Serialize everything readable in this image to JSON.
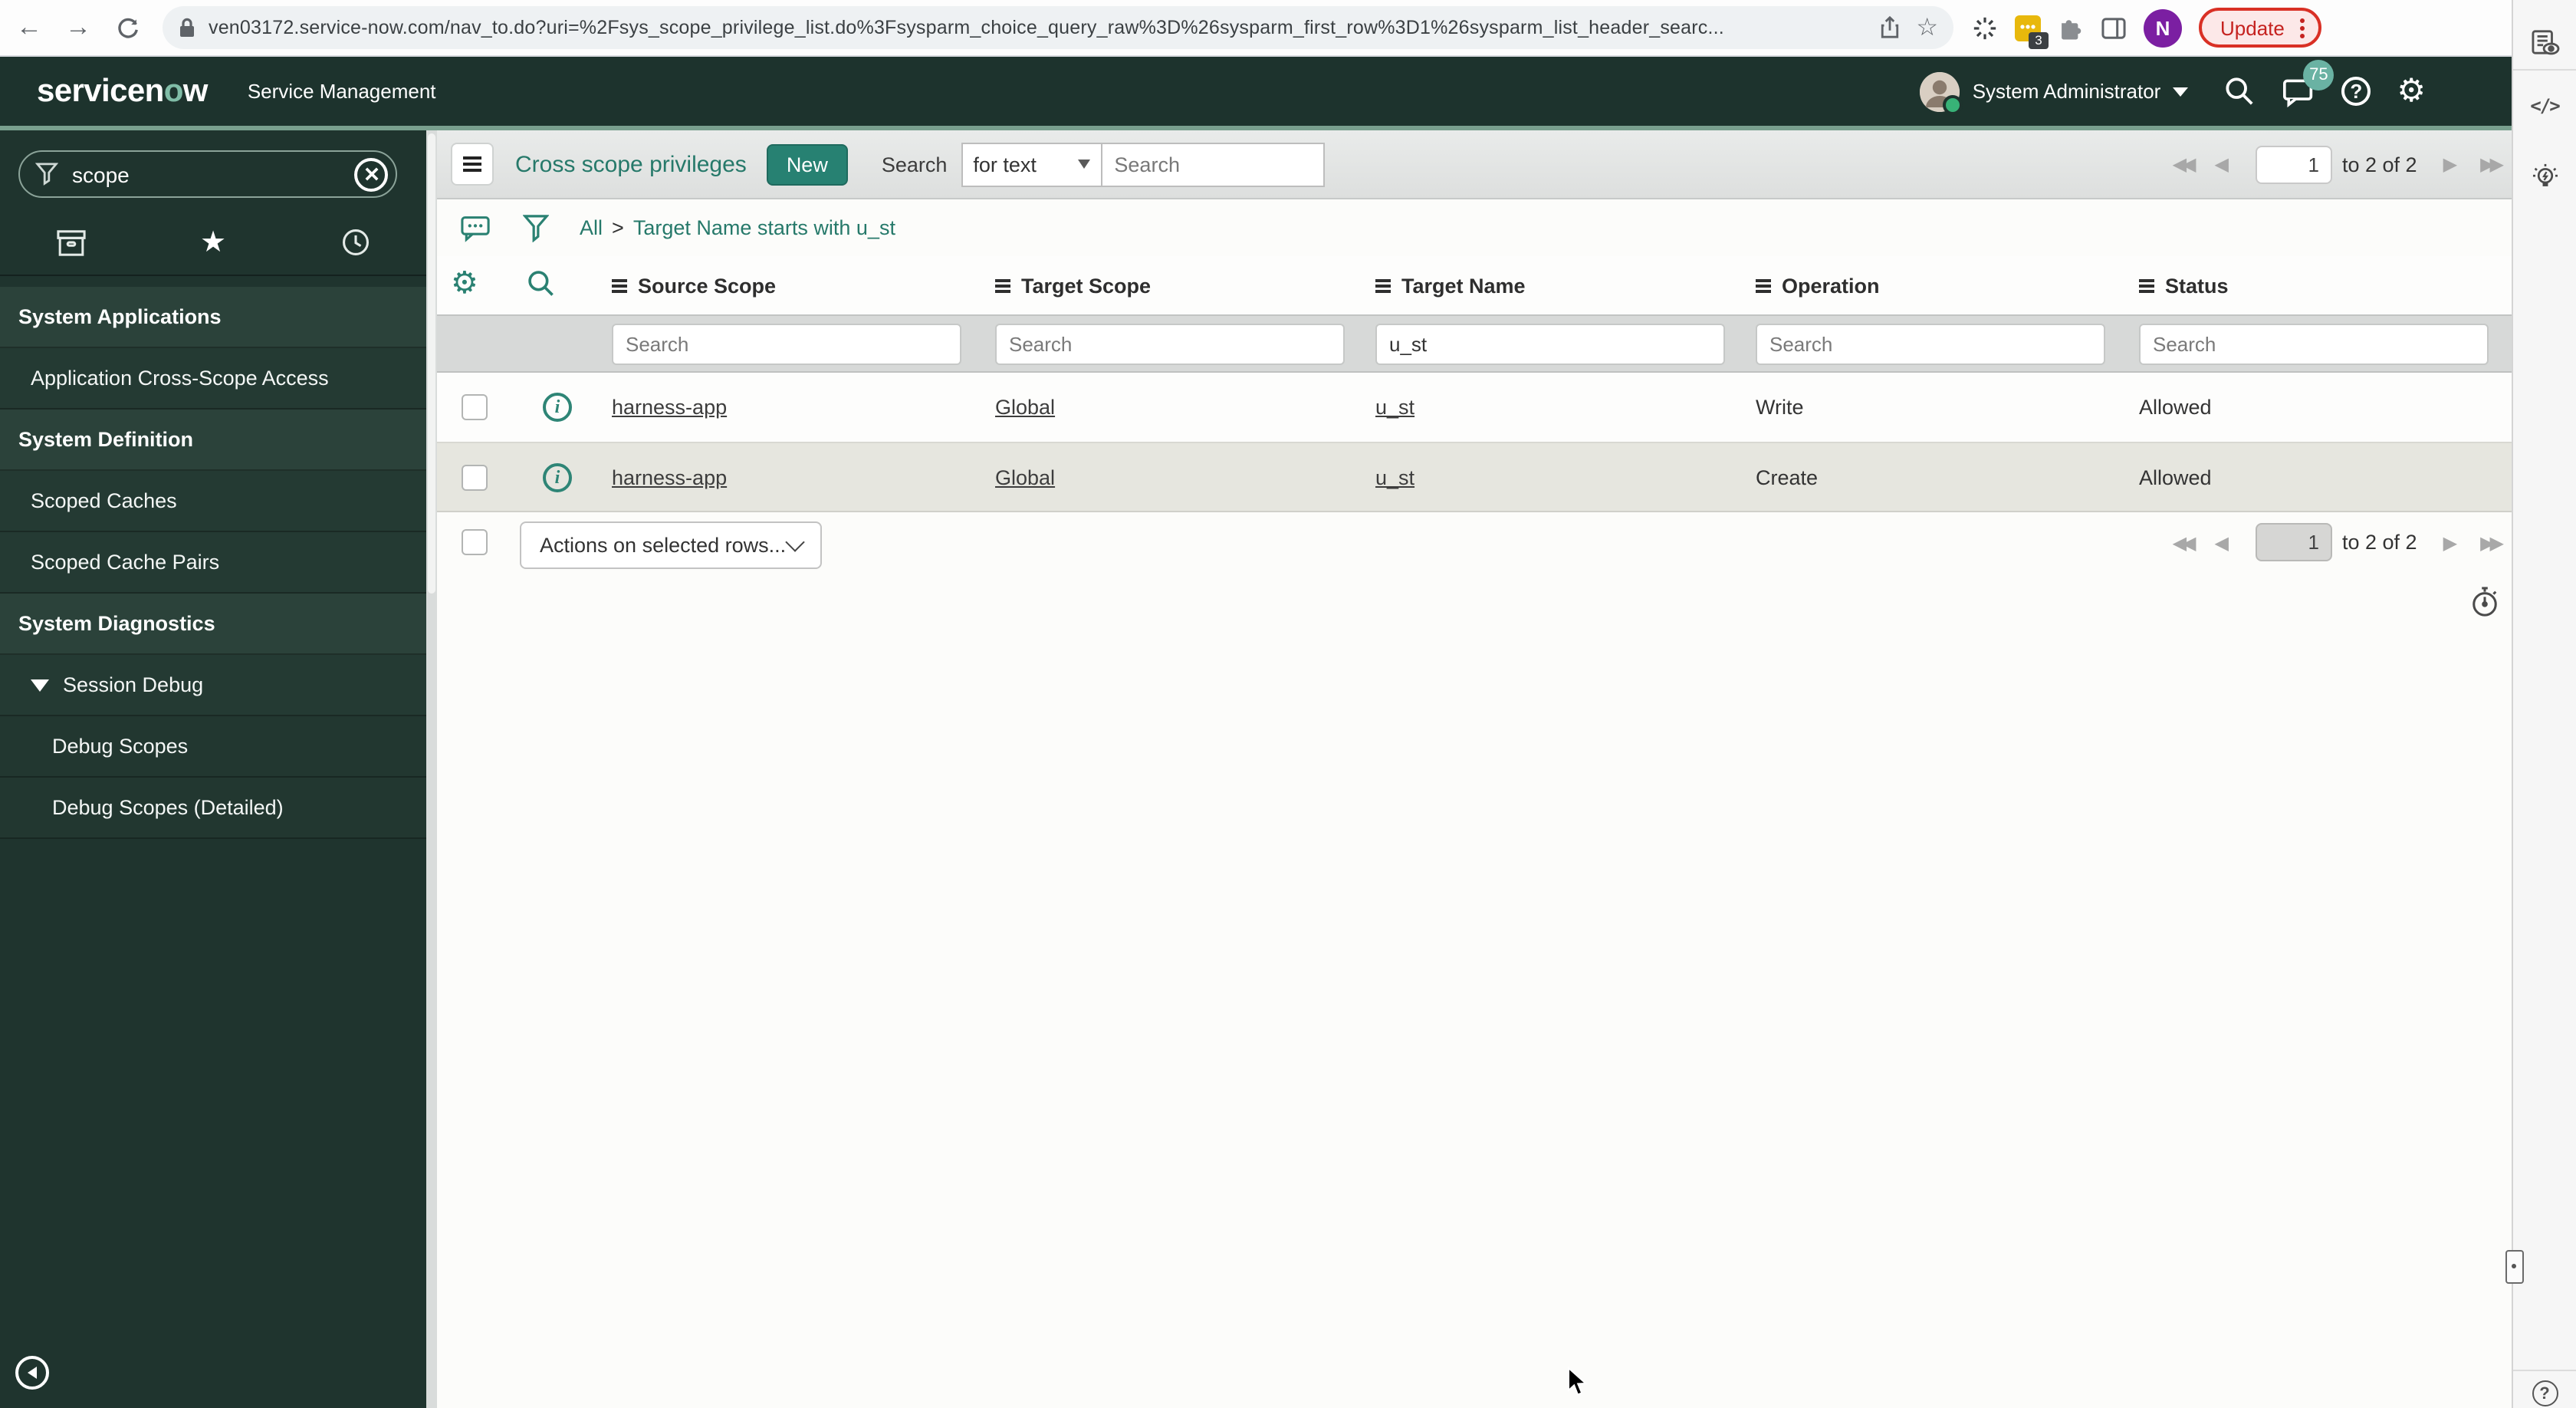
{
  "browser": {
    "url": "ven03172.service-now.com/nav_to.do?uri=%2Fsys_scope_privilege_list.do%3Fsysparm_choice_query_raw%3D%26sysparm_first_row%3D1%26sysparm_list_header_searc...",
    "update_label": "Update",
    "extension_badge": "3",
    "profile_initial": "N"
  },
  "banner": {
    "logo_part1": "servicen",
    "logo_o": "o",
    "logo_part2": "w",
    "product": "Service Management",
    "user": "System Administrator",
    "notification_count": "75",
    "help_glyph": "?",
    "gear_glyph": "⚙"
  },
  "sidebar": {
    "filter_value": "scope",
    "star_glyph": "★",
    "items": [
      {
        "label": "System Applications",
        "type": "header"
      },
      {
        "label": "Application Cross-Scope Access",
        "type": "item"
      },
      {
        "label": "System Definition",
        "type": "header"
      },
      {
        "label": "Scoped Caches",
        "type": "item"
      },
      {
        "label": "Scoped Cache Pairs",
        "type": "item"
      },
      {
        "label": "System Diagnostics",
        "type": "header"
      },
      {
        "label": "Session Debug",
        "type": "toggle"
      },
      {
        "label": "Debug Scopes",
        "type": "subitem"
      },
      {
        "label": "Debug Scopes (Detailed)",
        "type": "subitem"
      }
    ]
  },
  "list": {
    "title": "Cross scope privileges",
    "new_label": "New",
    "search_label": "Search",
    "search_type": "for text",
    "search_placeholder": "Search",
    "breadcrumb": {
      "root": "All",
      "sep": ">",
      "filter": "Target Name starts with u_st"
    },
    "columns": [
      "Source Scope",
      "Target Scope",
      "Target Name",
      "Operation",
      "Status"
    ],
    "filter_value_target_name": "u_st",
    "rows": [
      {
        "source_scope": "harness-app",
        "target_scope": "Global",
        "target_name": "u_st",
        "operation": "Write",
        "status": "Allowed"
      },
      {
        "source_scope": "harness-app",
        "target_scope": "Global",
        "target_name": "u_st",
        "operation": "Create",
        "status": "Allowed"
      }
    ],
    "actions_label": "Actions on selected rows...",
    "info_glyph": "i",
    "pagination": {
      "page": "1",
      "range": "to 2 of 2",
      "first": "◀◀",
      "prev": "◀",
      "next": "▶",
      "last": "▶▶"
    }
  },
  "right_strip": {
    "code_glyph": "</>",
    "help_glyph": "?"
  },
  "colors": {
    "banner_green": "#1d332d",
    "banner_border": "#79a08e",
    "teal_accent": "#278172",
    "sidebar_bg": "#1f342e",
    "alt_row": "#e6e6df",
    "update_red": "#c5221f",
    "badge_teal": "#6ab2a3",
    "avatar_purple": "#7b1fa2"
  }
}
